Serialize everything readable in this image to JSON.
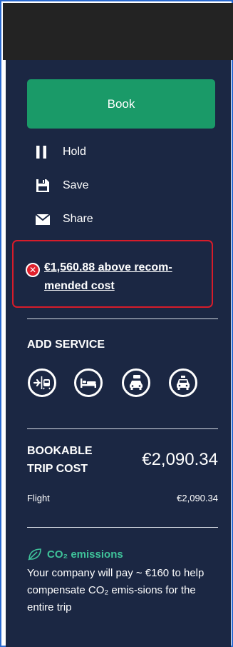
{
  "book_button": {
    "label": "Book"
  },
  "actions": [
    {
      "label": "Hold",
      "icon": "pause-icon"
    },
    {
      "label": "Save",
      "icon": "floppy-disk-icon"
    },
    {
      "label": "Share",
      "icon": "envelope-icon"
    }
  ],
  "warning": {
    "icon": "error-circle-icon",
    "text": "€1,560.88 above recom-mended cost"
  },
  "add_service": {
    "title": "ADD SERVICE",
    "services": [
      "flight-train-icon",
      "hotel-bed-icon",
      "car-rental-icon",
      "taxi-icon"
    ]
  },
  "trip_cost": {
    "label_line1": "BOOKABLE",
    "label_line2": "TRIP COST",
    "value": "€2,090.34",
    "items": [
      {
        "label": "Flight",
        "value": "€2,090.34"
      }
    ]
  },
  "co2": {
    "title": "CO₂ emissions",
    "text": "Your company will pay ~ €160 to help compensate CO₂ emis-sions for the entire trip"
  },
  "colors": {
    "panel_bg": "#1b2743",
    "book_green": "#1a9a68",
    "warning_red": "#d71c2a",
    "co2_green": "#3fc39a",
    "topbar": "#232323"
  }
}
